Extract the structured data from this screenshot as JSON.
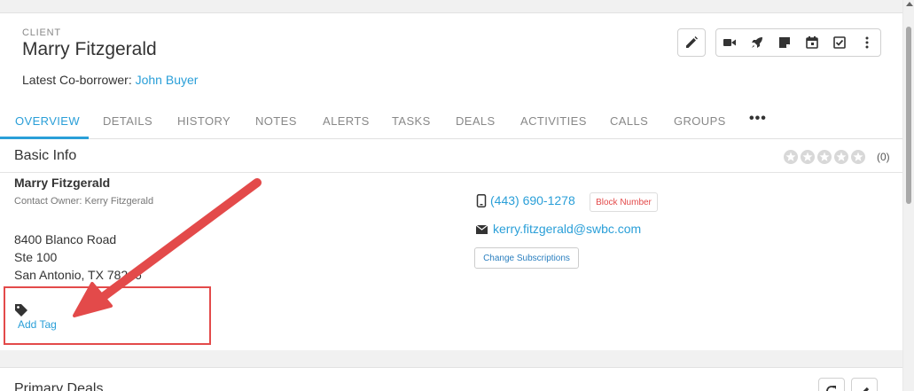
{
  "header": {
    "entity_label": "CLIENT",
    "client_name": "Marry Fitzgerald",
    "coborrower_prefix": "Latest Co-borrower:",
    "coborrower_name": "John Buyer"
  },
  "toolbar": {
    "edit_icon": "pencil-icon",
    "actions": [
      "video-icon",
      "rocket-icon",
      "note-icon",
      "calendar-icon",
      "checkbox-icon",
      "more-vertical-icon"
    ]
  },
  "tabs": [
    {
      "label": "OVERVIEW",
      "active": true
    },
    {
      "label": "DETAILS"
    },
    {
      "label": "HISTORY"
    },
    {
      "label": "NOTES"
    },
    {
      "label": "ALERTS"
    },
    {
      "label": "TASKS"
    },
    {
      "label": "DEALS"
    },
    {
      "label": "ACTIVITIES"
    },
    {
      "label": "CALLS"
    },
    {
      "label": "GROUPS"
    }
  ],
  "tabs_more": "•••",
  "basic_info": {
    "title": "Basic Info",
    "rating_count": "(0)",
    "rating_stars": 0,
    "contact_name": "Marry Fitzgerald",
    "contact_owner": "Contact Owner: Kerry Fitzgerald",
    "address_line1": "8400 Blanco Road",
    "address_line2": "Ste 100",
    "address_line3": "San Antonio, TX 78216",
    "add_tag": "Add Tag",
    "phone": "(443) 690-1278",
    "block_number": "Block Number",
    "email": "kerry.fitzgerald@swbc.com",
    "change_subscriptions": "Change Subscriptions"
  },
  "primary_deals": {
    "title": "Primary Deals"
  },
  "colors": {
    "accent": "#2a9fd8",
    "annotation_red": "#e34a4a"
  }
}
